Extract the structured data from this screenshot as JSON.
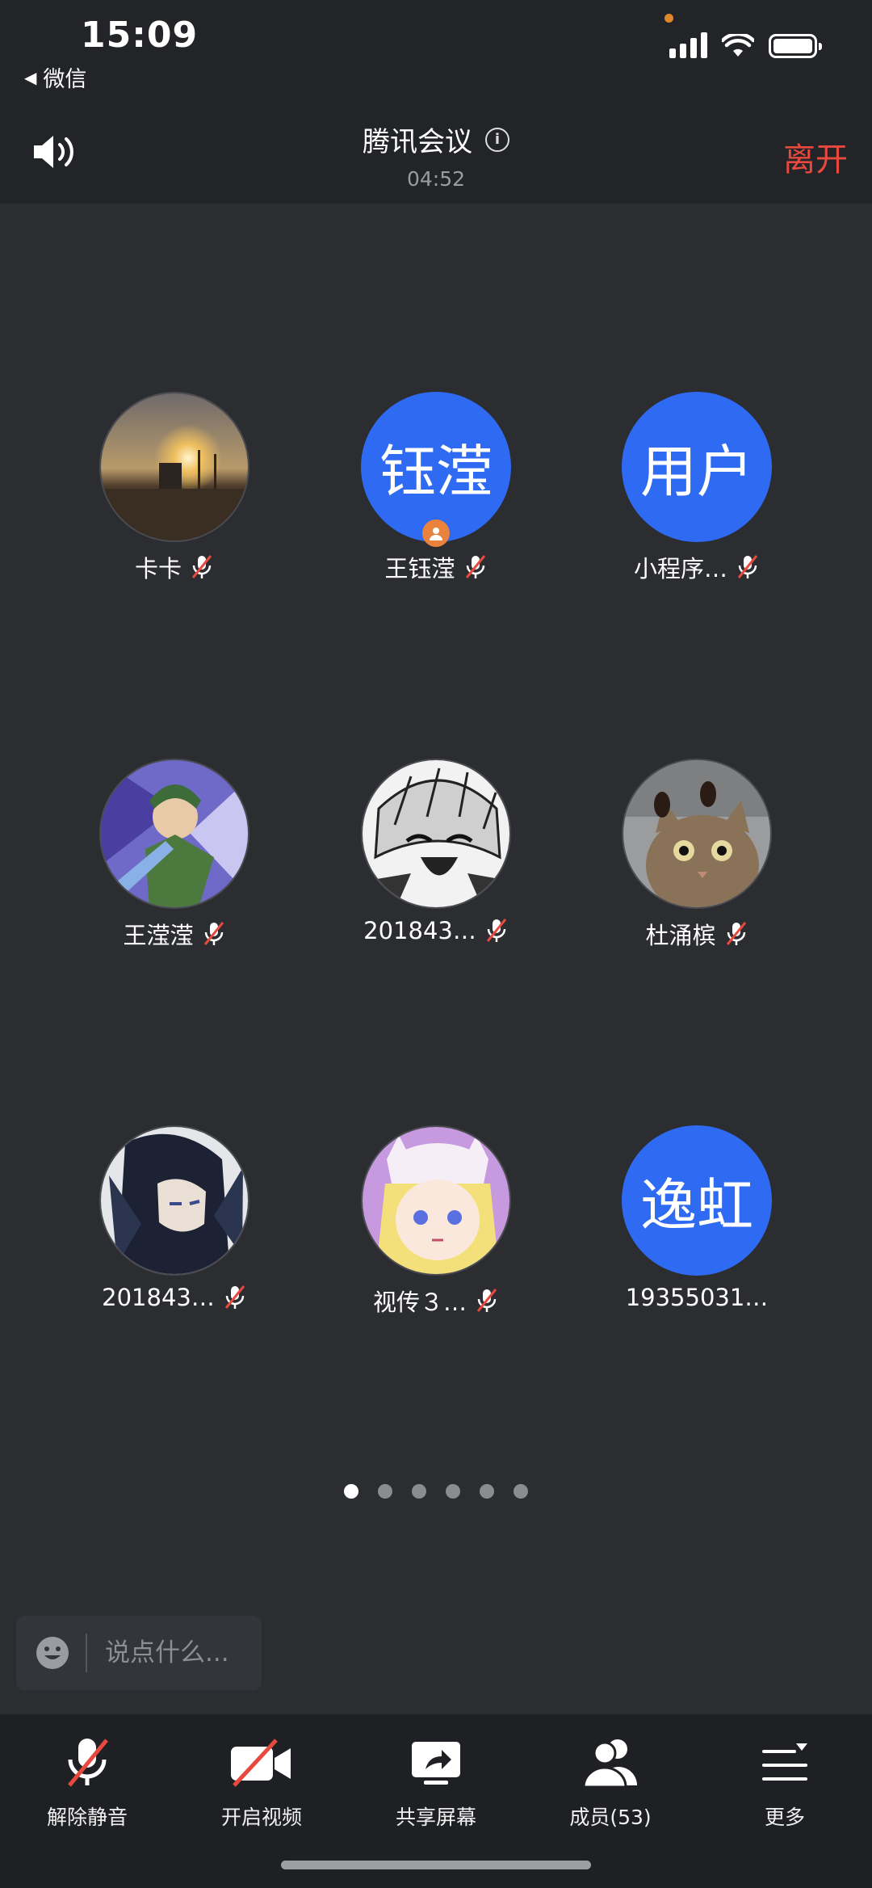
{
  "status_bar": {
    "time": "15:09",
    "back_app": "微信"
  },
  "header": {
    "title": "腾讯会议",
    "timer": "04:52",
    "leave": "离开"
  },
  "participants": [
    {
      "name": "卡卡",
      "avatar_text": "",
      "avatar_kind": "sunset-photo",
      "muted": true
    },
    {
      "name": "王钰滢",
      "avatar_text": "钰滢",
      "avatar_kind": "text",
      "muted": true,
      "host": true
    },
    {
      "name": "小程序…",
      "avatar_text": "用户",
      "avatar_kind": "text",
      "muted": true
    },
    {
      "name": "王滢滢",
      "avatar_text": "",
      "avatar_kind": "anime-green",
      "muted": true
    },
    {
      "name": "201843…",
      "avatar_text": "",
      "avatar_kind": "manga-bw",
      "muted": true
    },
    {
      "name": "杜涌槟",
      "avatar_text": "",
      "avatar_kind": "cat-photo",
      "muted": true
    },
    {
      "name": "201843…",
      "avatar_text": "",
      "avatar_kind": "anime-dark",
      "muted": true
    },
    {
      "name": "视传３…",
      "avatar_text": "",
      "avatar_kind": "pixel-girl",
      "muted": true
    },
    {
      "name": "19355031…",
      "avatar_text": "逸虹",
      "avatar_kind": "text",
      "muted": false
    }
  ],
  "pagination": {
    "pages": 6,
    "current": 1
  },
  "chat": {
    "placeholder": "说点什么..."
  },
  "toolbar": {
    "unmute": "解除静音",
    "video": "开启视频",
    "share": "共享屏幕",
    "members": "成员(53)",
    "more": "更多"
  },
  "colors": {
    "leave": "#e8493f",
    "avatar_blue": "#2f6bf2",
    "host_badge": "#e8823c"
  }
}
